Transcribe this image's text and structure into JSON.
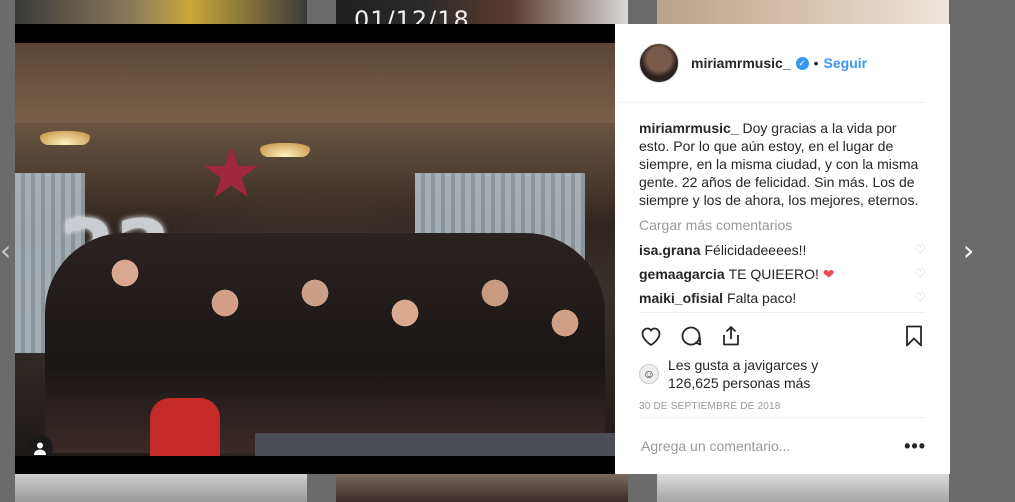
{
  "background": {
    "thumb_date": "01/12/18"
  },
  "photo": {
    "balloon_text": "22"
  },
  "post": {
    "username": "miriamrmusic_",
    "verified": true,
    "separator": "•",
    "follow_label": "Seguir",
    "caption_user": "miriamrmusic_",
    "caption_text": "Doy gracias a la vida por esto. Por lo que aún estoy, en el lugar de siempre, en la misma ciudad, y con la misma gente. 22 años de felicidad. Sin más. Los de siempre y los de ahora, los mejores, eternos.",
    "load_more": "Cargar más comentarios",
    "comments": [
      {
        "user": "isa.grana",
        "text": "Félicidadeeees!!"
      },
      {
        "user": "gemaagarcia",
        "text": "TE QUIEERO!"
      },
      {
        "user": "maiki_ofisial",
        "text": "Falta paco!"
      }
    ],
    "likes_line1": "Les gusta a javigarces y",
    "likes_line2": "126,625 personas más",
    "date": "30 de septiembre de 2018",
    "comment_placeholder": "Agrega un comentario...",
    "more_options": "•••"
  },
  "colors": {
    "link": "#3897f0",
    "like_red": "#ed4956"
  },
  "icons": [
    "verified-badge-icon",
    "heart-icon",
    "comment-icon",
    "share-icon",
    "bookmark-icon",
    "next-arrow-icon",
    "prev-arrow-icon",
    "user-tag-icon"
  ]
}
